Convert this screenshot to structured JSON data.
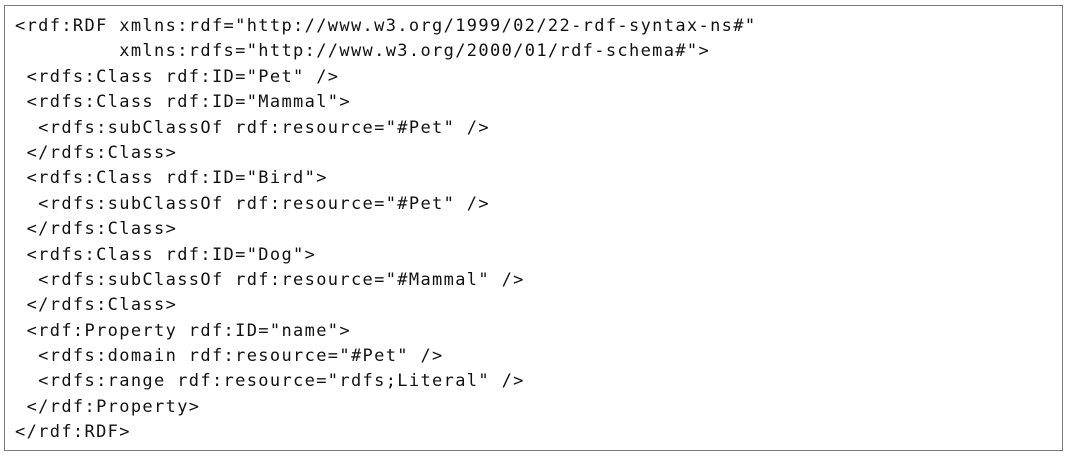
{
  "code": {
    "lines": [
      "<rdf:RDF xmlns:rdf=\"http://www.w3.org/1999/02/22-rdf-syntax-ns#\"",
      "         xmlns:rdfs=\"http://www.w3.org/2000/01/rdf-schema#\">",
      " <rdfs:Class rdf:ID=\"Pet\" />",
      " <rdfs:Class rdf:ID=\"Mammal\">",
      "  <rdfs:subClassOf rdf:resource=\"#Pet\" />",
      " </rdfs:Class>",
      " <rdfs:Class rdf:ID=\"Bird\">",
      "  <rdfs:subClassOf rdf:resource=\"#Pet\" />",
      " </rdfs:Class>",
      " <rdfs:Class rdf:ID=\"Dog\">",
      "  <rdfs:subClassOf rdf:resource=\"#Mammal\" />",
      " </rdfs:Class>",
      " <rdf:Property rdf:ID=\"name\">",
      "  <rdfs:domain rdf:resource=\"#Pet\" />",
      "  <rdfs:range rdf:resource=\"rdfs;Literal\" />",
      " </rdf:Property>",
      "</rdf:RDF>"
    ]
  }
}
